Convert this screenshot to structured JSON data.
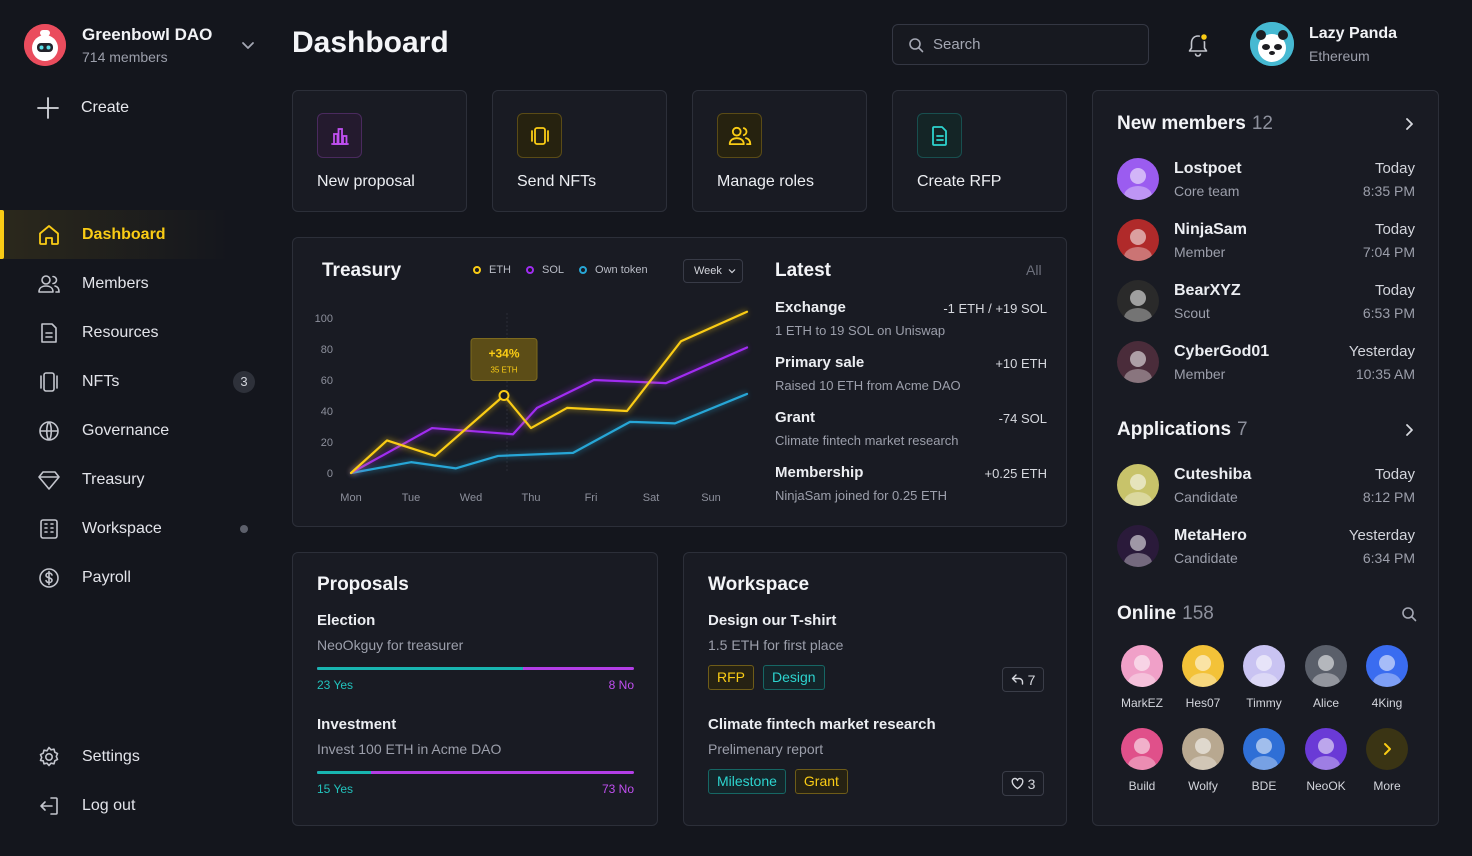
{
  "org": {
    "name": "Greenbowl DAO",
    "members": "714 members"
  },
  "create_label": "Create",
  "nav": [
    {
      "label": "Dashboard",
      "icon": "home-icon",
      "active": true
    },
    {
      "label": "Members",
      "icon": "users-icon"
    },
    {
      "label": "Resources",
      "icon": "document-icon"
    },
    {
      "label": "NFTs",
      "icon": "nft-icon",
      "badge": "3"
    },
    {
      "label": "Governance",
      "icon": "globe-icon"
    },
    {
      "label": "Treasury",
      "icon": "diamond-icon"
    },
    {
      "label": "Workspace",
      "icon": "building-icon",
      "dot": true
    },
    {
      "label": "Payroll",
      "icon": "dollar-icon"
    }
  ],
  "bottom_nav": [
    {
      "label": "Settings",
      "icon": "gear-icon"
    },
    {
      "label": "Log out",
      "icon": "logout-icon"
    }
  ],
  "header": {
    "title": "Dashboard",
    "search_placeholder": "Search",
    "user_name": "Lazy Panda",
    "user_network": "Ethereum"
  },
  "quick_actions": [
    {
      "label": "New proposal",
      "icon": "bar-chart-icon",
      "color": "#c04ff0"
    },
    {
      "label": "Send NFTs",
      "icon": "cards-icon",
      "color": "#facc15"
    },
    {
      "label": "Manage roles",
      "icon": "users-icon",
      "color": "#facc15"
    },
    {
      "label": "Create RFP",
      "icon": "document-icon",
      "color": "#2dd4cf"
    }
  ],
  "treasury": {
    "title": "Treasury",
    "legend": [
      {
        "name": "ETH",
        "color": "#facc15"
      },
      {
        "name": "SOL",
        "color": "#a02cf0"
      },
      {
        "name": "Own token",
        "color": "#27a6d6"
      }
    ],
    "range": "Week",
    "tooltip_pct": "+34%",
    "tooltip_val": "35 ETH"
  },
  "chart_data": {
    "type": "line",
    "categories": [
      "Mon",
      "Tue",
      "Wed",
      "Thu",
      "Fri",
      "Sat",
      "Sun"
    ],
    "yticks": [
      0,
      20,
      40,
      60,
      80,
      100
    ],
    "ylim": [
      0,
      100
    ],
    "series": [
      {
        "name": "ETH",
        "color": "#facc15",
        "x": [
          0,
          0.6,
          1.4,
          2.55,
          3.0,
          3.6,
          4.6,
          5.5,
          6.6
        ],
        "values": [
          0,
          21,
          11,
          50,
          29,
          42,
          40,
          85,
          104
        ]
      },
      {
        "name": "SOL",
        "color": "#a02cf0",
        "x": [
          0,
          1.35,
          2.7,
          3.1,
          4.05,
          5.25,
          6.6
        ],
        "values": [
          0,
          29,
          25,
          42,
          60,
          58,
          81
        ]
      },
      {
        "name": "Own token",
        "color": "#27a6d6",
        "x": [
          0,
          1.0,
          1.75,
          2.45,
          3.7,
          4.65,
          5.4,
          6.6
        ],
        "values": [
          0,
          7,
          3,
          11,
          13,
          33,
          32,
          51
        ]
      }
    ]
  },
  "latest": {
    "title": "Latest",
    "all_label": "All",
    "items": [
      {
        "name": "Exchange",
        "amount": "-1 ETH / +19 SOL",
        "desc": "1 ETH to 19 SOL on Uniswap"
      },
      {
        "name": "Primary sale",
        "amount": "+10 ETH",
        "desc": "Raised 10 ETH from Acme DAO"
      },
      {
        "name": "Grant",
        "amount": "-74 SOL",
        "desc": "Climate fintech market research"
      },
      {
        "name": "Membership",
        "amount": "+0.25 ETH",
        "desc": "NinjaSam joined for 0.25 ETH"
      }
    ]
  },
  "proposals": {
    "title": "Proposals",
    "items": [
      {
        "name": "Election",
        "desc": "NeoOkguy for treasurer",
        "yes": "23 Yes",
        "no": "8 No",
        "yes_fraction": 0.65
      },
      {
        "name": "Investment",
        "desc": "Invest 100 ETH in Acme DAO",
        "yes": "15 Yes",
        "no": "73 No",
        "yes_fraction": 0.17
      }
    ]
  },
  "workspace": {
    "title": "Workspace",
    "items": [
      {
        "name": "Design our T-shirt",
        "desc": "1.5 ETH for first place",
        "tags": [
          "RFP",
          "Design"
        ],
        "count": "7",
        "count_icon": "reply-icon"
      },
      {
        "name": "Climate fintech market research",
        "desc": "Prelimenary report",
        "tags": [
          "Milestone",
          "Grant"
        ],
        "count": "3",
        "count_icon": "heart-icon"
      }
    ]
  },
  "new_members": {
    "title": "New members",
    "count": "12",
    "items": [
      {
        "name": "Lostpoet",
        "role": "Core team",
        "day": "Today",
        "time": "8:35 PM",
        "color": "#9b5cf0"
      },
      {
        "name": "NinjaSam",
        "role": "Member",
        "day": "Today",
        "time": "7:04 PM",
        "color": "#b02a2a"
      },
      {
        "name": "BearXYZ",
        "role": "Scout",
        "day": "Today",
        "time": "6:53 PM",
        "color": "#2a2a2a"
      },
      {
        "name": "CyberGod01",
        "role": "Member",
        "day": "Yesterday",
        "time": "10:35 AM",
        "color": "#4a2c3a"
      }
    ]
  },
  "applications": {
    "title": "Applications",
    "count": "7",
    "items": [
      {
        "name": "Cuteshiba",
        "role": "Candidate",
        "day": "Today",
        "time": "8:12 PM",
        "color": "#c8c36a"
      },
      {
        "name": "MetaHero",
        "role": "Candidate",
        "day": "Yesterday",
        "time": "6:34 PM",
        "color": "#2a1a3a"
      }
    ]
  },
  "online": {
    "title": "Online",
    "count": "158",
    "users": [
      {
        "name": "MarkEZ",
        "color": "#f0a0c8"
      },
      {
        "name": "Hes07",
        "color": "#f3c238"
      },
      {
        "name": "Timmy",
        "color": "#c9c3f2"
      },
      {
        "name": "Alice",
        "color": "#5a5f6a"
      },
      {
        "name": "4King",
        "color": "#3a6cf0"
      },
      {
        "name": "Build",
        "color": "#e0508a"
      },
      {
        "name": "Wolfy",
        "color": "#b8a890"
      },
      {
        "name": "BDE",
        "color": "#2f6fd6"
      },
      {
        "name": "NeoOK",
        "color": "#6a3ad6"
      }
    ],
    "more_label": "More"
  }
}
